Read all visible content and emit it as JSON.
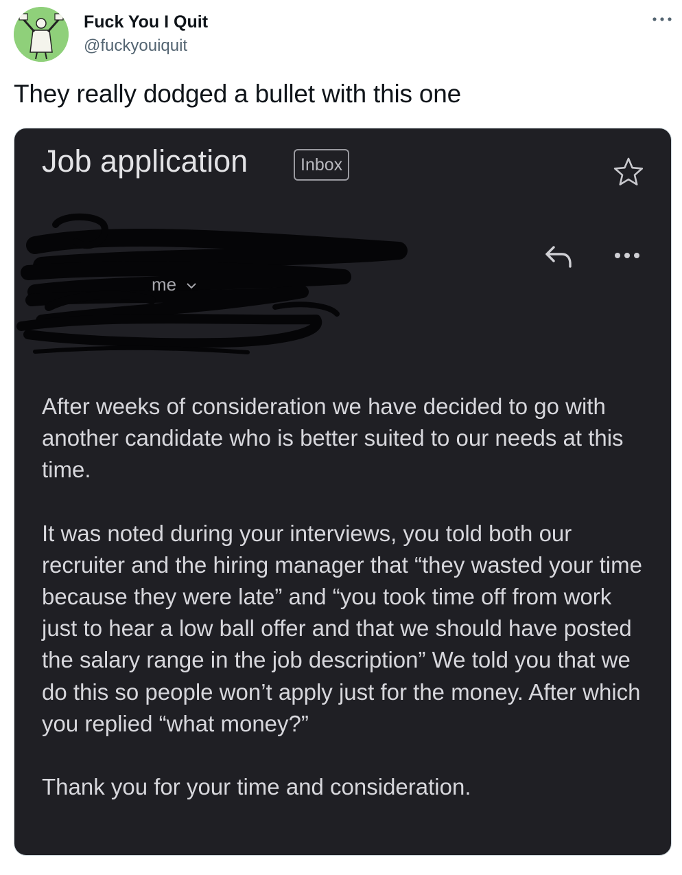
{
  "tweet": {
    "display_name": "Fuck You I Quit",
    "handle": "@fuckyouiquit",
    "text": "They really dodged a bullet with this one",
    "more_icon": "ellipsis-icon"
  },
  "email": {
    "subject": "Job application",
    "label": "Inbox",
    "recipient": "me",
    "icons": {
      "star": "star-icon",
      "reply": "reply-icon",
      "more": "more-icon",
      "chevron": "chevron-down-icon"
    },
    "body": [
      "After weeks of consideration we have decided to go with another candidate who is better suited to our needs at this time.",
      "It was noted during your interviews, you told both our recruiter and the hiring manager that “they wasted your time because they were late” and “you took time off from work just to hear a low ball offer and that we should have posted the salary range in the job description” We told you that we do this so people won’t apply just for the money. After which you replied “what money?”",
      "Thank you for your time and consideration."
    ]
  },
  "colors": {
    "email_background": "#1f1f24",
    "email_text": "#d7d7dc",
    "avatar_background": "#8fd07a",
    "handle_text": "#536471"
  }
}
